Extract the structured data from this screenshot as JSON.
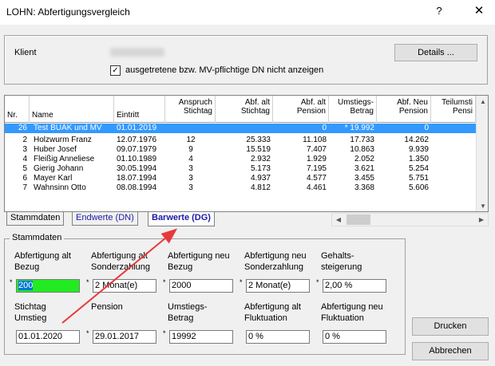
{
  "window": {
    "title": "LOHN: Abfertigungsvergleich",
    "help": "?",
    "close": "✕"
  },
  "client": {
    "label": "Klient",
    "details_button": "Details ...",
    "checkbox_label": "ausgetretene bzw. MV-pflichtige DN nicht anzeigen",
    "checkbox_checked": "✓"
  },
  "grid": {
    "headers": {
      "nr": "Nr.",
      "name": "Name",
      "eintritt": "Eintritt",
      "anspruch": "Anspruch\nStichtag",
      "abf_alt_stichtag": "Abf. alt\nStichtag",
      "abf_alt_pension": "Abf. alt\nPension",
      "umstiegs_betrag": "Umstiegs-\nBetrag",
      "abf_neu_pension": "Abf. Neu\nPension",
      "teilumst": "Teilumsti\nPensi"
    },
    "rows": [
      {
        "nr": "26",
        "name": "Test BUAK und MV",
        "eintritt": "01.01.2019",
        "anspruch": "",
        "abf_alt_stichtag": "",
        "abf_alt_pension": "0",
        "umstiegs_betrag": "* 19.992",
        "abf_neu_pension": "0"
      },
      {
        "nr": "2",
        "name": "Holzwurm Franz",
        "eintritt": "12.07.1976",
        "anspruch": "12",
        "abf_alt_stichtag": "25.333",
        "abf_alt_pension": "11.108",
        "umstiegs_betrag": "17.733",
        "abf_neu_pension": "14.262"
      },
      {
        "nr": "3",
        "name": "Huber Josef",
        "eintritt": "09.07.1979",
        "anspruch": "9",
        "abf_alt_stichtag": "15.519",
        "abf_alt_pension": "7.407",
        "umstiegs_betrag": "10.863",
        "abf_neu_pension": "9.939"
      },
      {
        "nr": "4",
        "name": "Fleißig Anneliese",
        "eintritt": "01.10.1989",
        "anspruch": "4",
        "abf_alt_stichtag": "2.932",
        "abf_alt_pension": "1.929",
        "umstiegs_betrag": "2.052",
        "abf_neu_pension": "1.350"
      },
      {
        "nr": "5",
        "name": "Gierig Johann",
        "eintritt": "30.05.1994",
        "anspruch": "3",
        "abf_alt_stichtag": "5.173",
        "abf_alt_pension": "7.195",
        "umstiegs_betrag": "3.621",
        "abf_neu_pension": "5.254"
      },
      {
        "nr": "6",
        "name": "Mayer Karl",
        "eintritt": "18.07.1994",
        "anspruch": "3",
        "abf_alt_stichtag": "4.937",
        "abf_alt_pension": "4.577",
        "umstiegs_betrag": "3.455",
        "abf_neu_pension": "5.751"
      },
      {
        "nr": "7",
        "name": "Wahnsinn Otto",
        "eintritt": "08.08.1994",
        "anspruch": "3",
        "abf_alt_stichtag": "4.812",
        "abf_alt_pension": "4.461",
        "umstiegs_betrag": "3.368",
        "abf_neu_pension": "5.606"
      }
    ],
    "scroll_up": "▲",
    "scroll_down": "▼",
    "scroll_left": "◀",
    "scroll_right": "▶"
  },
  "tabs": [
    {
      "label": "Stammdaten"
    },
    {
      "label": "Endwerte (DN)"
    },
    {
      "label": "Barwerte (DG)"
    }
  ],
  "stammdaten": {
    "legend": "Stammdaten",
    "fields": [
      {
        "label": "Abfertigung alt\nBezug",
        "value": "200",
        "marker": "*"
      },
      {
        "label": "Abfertigung alt\nSonderzahlung",
        "value": "2  Monat(e)",
        "marker": "*"
      },
      {
        "label": "Abfertigung neu\nBezug",
        "value": "2000",
        "marker": "*"
      },
      {
        "label": "Abfertigung neu\nSonderzahlung",
        "value": "2  Monat(e)",
        "marker": "*"
      },
      {
        "label": "Gehalts-\nsteigerung",
        "value": "2,00  %",
        "marker": "*"
      },
      {
        "label": "Stichtag\nUmstieg",
        "value": "01.01.2020",
        "marker": ""
      },
      {
        "label": "Pension",
        "value": "29.01.2017",
        "marker": "*"
      },
      {
        "label": "Umstiegs-\nBetrag",
        "value": "19992",
        "marker": "*"
      },
      {
        "label": "Abfertigung alt\nFluktuation",
        "value": "0  %",
        "marker": ""
      },
      {
        "label": "Abfertigung neu\nFluktuation",
        "value": "0  %",
        "marker": ""
      }
    ]
  },
  "buttons": {
    "print": "Drucken",
    "cancel": "Abbrechen"
  },
  "colors": {
    "selection": "#3399ff",
    "highlight_field": "#21ec21",
    "arrow": "#e8393b",
    "active_tab_text": "#1a1aa6"
  }
}
